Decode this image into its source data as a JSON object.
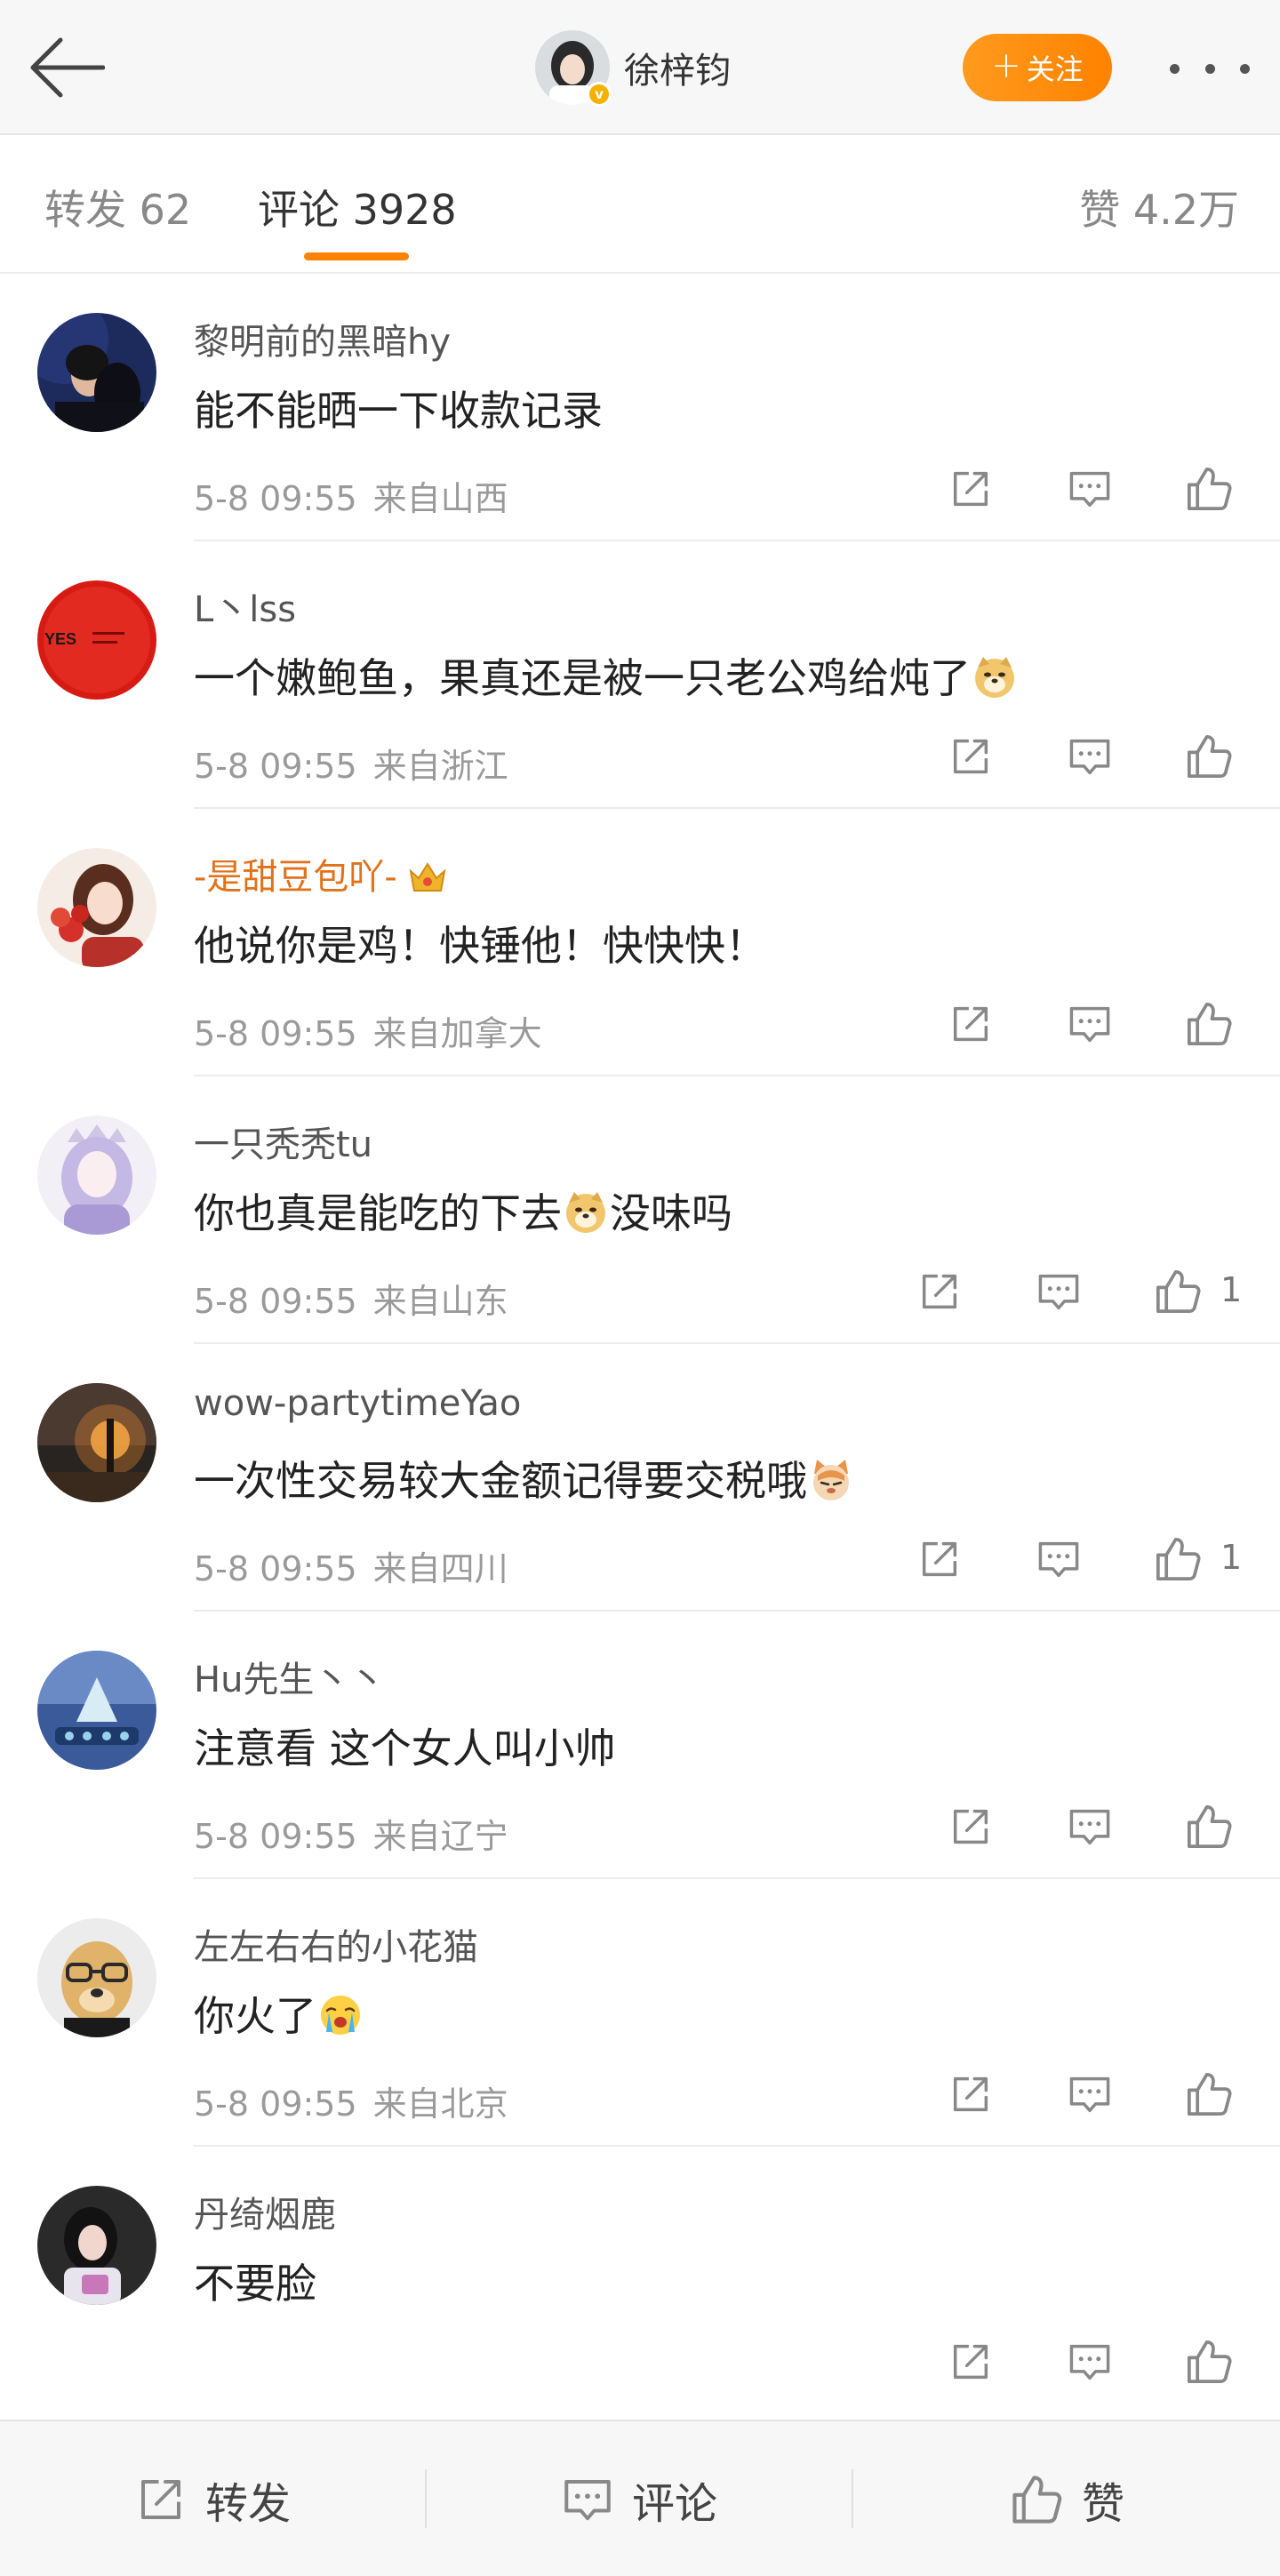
{
  "header": {
    "profile_name": "徐梓钧",
    "follow_label": "关注"
  },
  "tabs": {
    "repost": "转发 62",
    "comment": "评论 3928",
    "like": "赞 4.2万"
  },
  "comments": [
    {
      "user": "黎明前的黑暗hy",
      "text": "能不能晒一下收款记录",
      "time": "5-8 09:55",
      "location": "来自山西",
      "likes": ""
    },
    {
      "user": "L丶lss",
      "text_before": "一个嫩鲍鱼，果真还是被一只老公鸡给炖了",
      "emoji": "doge",
      "time": "5-8 09:55",
      "location": "来自浙江",
      "likes": ""
    },
    {
      "user": "-是甜豆包吖-",
      "text": "他说你是鸡！快锤他！快快快！",
      "time": "5-8 09:55",
      "location": "来自加拿大",
      "likes": ""
    },
    {
      "user": "一只秃秃tu",
      "text_before": "你也真是能吃的下去",
      "emoji": "doge",
      "text_after": "没味吗",
      "time": "5-8 09:55",
      "location": "来自山东",
      "likes": "1"
    },
    {
      "user": "wow-partytimeYao",
      "text_before": "一次性交易较大金额记得要交税哦",
      "emoji": "cat",
      "time": "5-8 09:55",
      "location": "来自四川",
      "likes": "1"
    },
    {
      "user": "Hu先生丶丶",
      "text": "注意看 这个女人叫小帅",
      "time": "5-8 09:55",
      "location": "来自辽宁",
      "likes": ""
    },
    {
      "user": "左左右右的小花猫",
      "text_before": "你火了",
      "emoji": "cry",
      "time": "5-8 09:55",
      "location": "来自北京",
      "likes": ""
    },
    {
      "user": "丹绮烟鹿",
      "text": "不要脸",
      "time": "",
      "location": "",
      "likes": ""
    }
  ],
  "bottom_bar": {
    "repost": "转发",
    "comment": "评论",
    "like": "赞"
  },
  "colors": {
    "accent": "#ff8200",
    "vip_name": "#e2721a",
    "muted": "#9a9a9a",
    "verified": "#f5b100"
  },
  "icons": [
    "back-arrow-icon",
    "verified-icon",
    "more-icon",
    "share-icon",
    "comment-icon",
    "like-icon",
    "crown-icon"
  ]
}
